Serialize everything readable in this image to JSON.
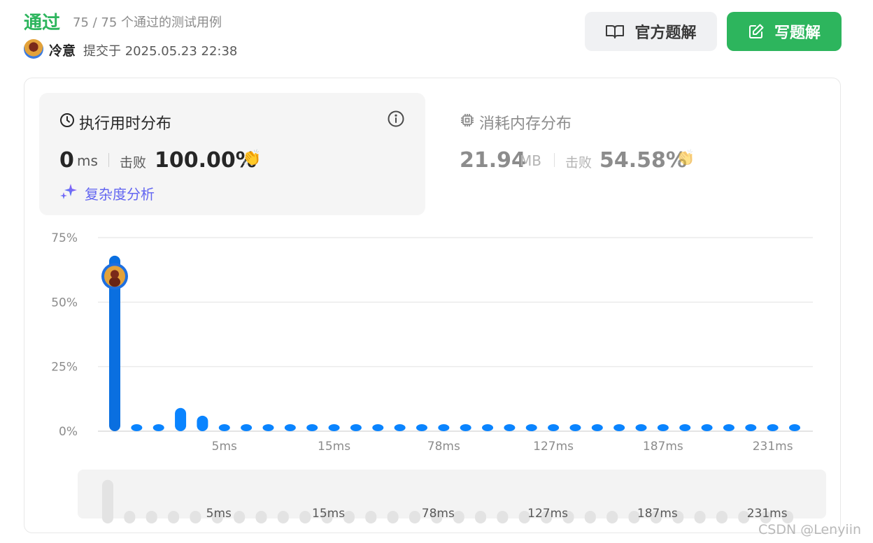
{
  "header": {
    "status": "通过",
    "cases": "75 / 75 个通过的测试用例",
    "user": "冷意",
    "submitted": "提交于 2025.05.23 22:38"
  },
  "buttons": {
    "official_solution": "官方题解",
    "write_solution": "写题解"
  },
  "runtime_panel": {
    "title": "执行用时分布",
    "value": "0",
    "unit": "ms",
    "beat_label": "击败",
    "beat_pct": "100.00%",
    "analysis_link": "复杂度分析"
  },
  "memory_panel": {
    "title": "消耗内存分布",
    "value": "21.94",
    "unit": "MB",
    "beat_label": "击败",
    "beat_pct": "54.58%"
  },
  "chart_data": {
    "type": "bar",
    "ylabel": "",
    "xlabel": "",
    "ylim": [
      0,
      75
    ],
    "ytick_labels": [
      "0%",
      "25%",
      "50%",
      "75%"
    ],
    "ytick_values": [
      0,
      25,
      50,
      75
    ],
    "xtick_labels": [
      "5ms",
      "15ms",
      "78ms",
      "127ms",
      "187ms",
      "231ms"
    ],
    "xtick_bar_index": [
      5,
      10,
      15,
      20,
      25,
      30
    ],
    "values": [
      68,
      0.6,
      0.6,
      9,
      6,
      0.6,
      0.6,
      0.6,
      0.6,
      0.6,
      0.6,
      0.6,
      0.6,
      0.6,
      0.6,
      0.6,
      0.6,
      0.6,
      0.6,
      0.6,
      0.6,
      0.6,
      0.6,
      0.6,
      0.6,
      0.6,
      0.6,
      0.6,
      0.6,
      0.6,
      0.6,
      0.6
    ],
    "highlight_index": 0,
    "highlight_value": 60,
    "colors": {
      "bar": "#0a84ff",
      "bar_highlight": "#0a6fe0",
      "grid": "#ebebeb",
      "axis_text": "#8c8c8c",
      "mini": "#e3e3e3"
    }
  },
  "colors": {
    "accent": "#2db55d",
    "panel": "#f5f5f5",
    "link": "#6366f1"
  },
  "watermark": "CSDN @Lenyiin"
}
